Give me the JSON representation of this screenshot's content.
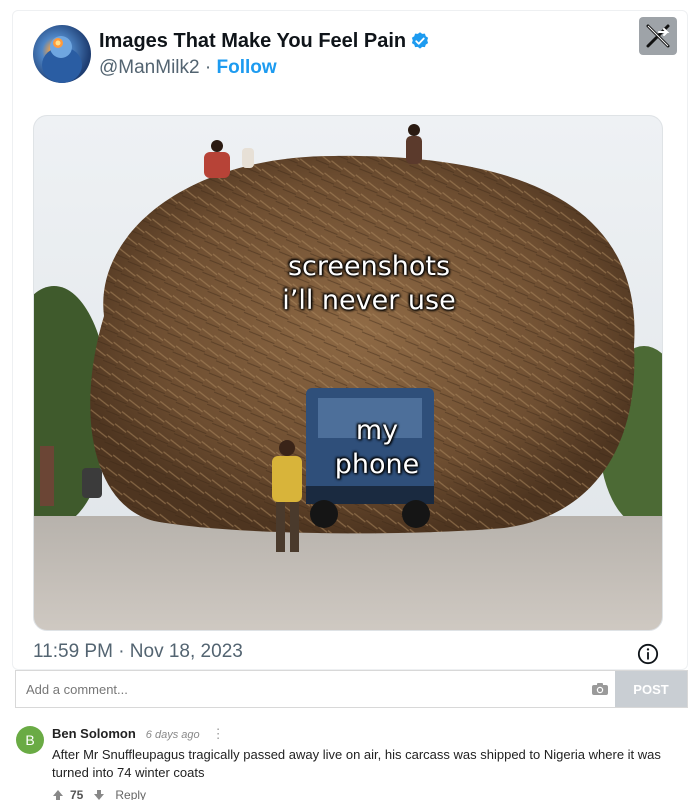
{
  "tweet": {
    "display_name": "Images That Make You Feel Pain",
    "handle": "@ManMilk2",
    "separator": " · ",
    "follow_label": "Follow",
    "timestamp": "11:59 PM · Nov 18, 2023",
    "brand_icon": "x-logo-icon",
    "verified_icon": "verified-badge-icon",
    "accent_color": "#1d9bf0"
  },
  "meme": {
    "caption_top_line1": "screenshots",
    "caption_top_line2": "i’ll never use",
    "caption_bottom_line1": "my",
    "caption_bottom_line2": "phone"
  },
  "comment_form": {
    "placeholder": "Add a comment...",
    "post_label": "POST"
  },
  "comments": [
    {
      "avatar_letter": "B",
      "author": "Ben Solomon",
      "time": "6 days ago",
      "more": "⋮",
      "text": "After Mr Snuffleupagus tragically passed away live on air, his carcass was shipped to Nigeria where it was turned into 74 winter coats",
      "upvotes": "75",
      "reply_label": "Reply"
    }
  ]
}
